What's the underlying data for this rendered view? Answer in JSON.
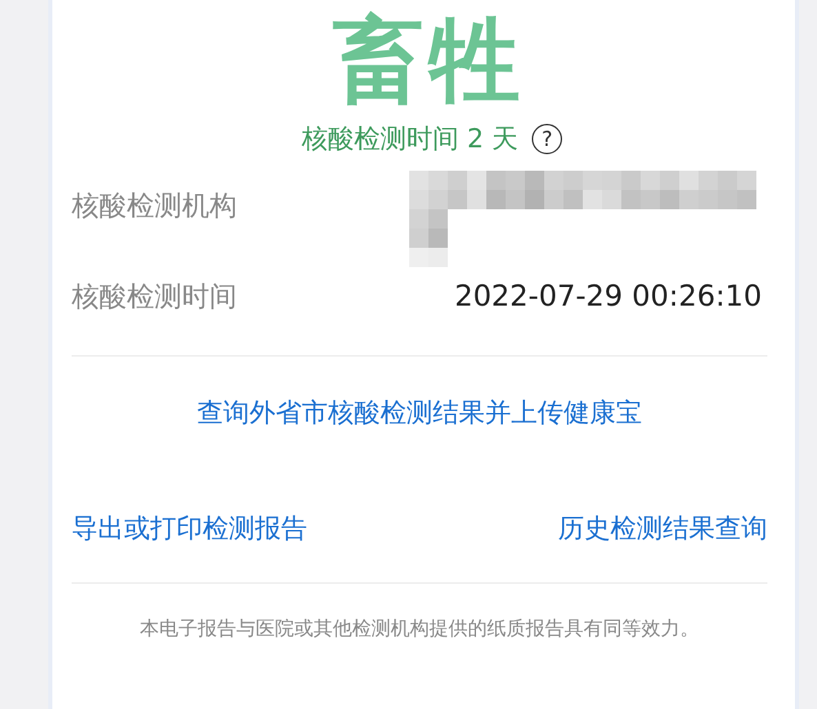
{
  "result": {
    "text": "畜牲",
    "caption": "核酸检测时间 2 天",
    "help": "?"
  },
  "fields": [
    {
      "label": "核酸检测机构",
      "kind": "redacted"
    },
    {
      "label": "核酸检测时间",
      "kind": "text",
      "value": "2022-07-29 00:26:10"
    }
  ],
  "link_main": "查询外省市核酸检测结果并上传健康宝",
  "links": [
    "导出或打印检测报告",
    "历史检测结果查询"
  ],
  "footer": "本电子报告与医院或其他检测机构提供的纸质报告具有同等效力。"
}
